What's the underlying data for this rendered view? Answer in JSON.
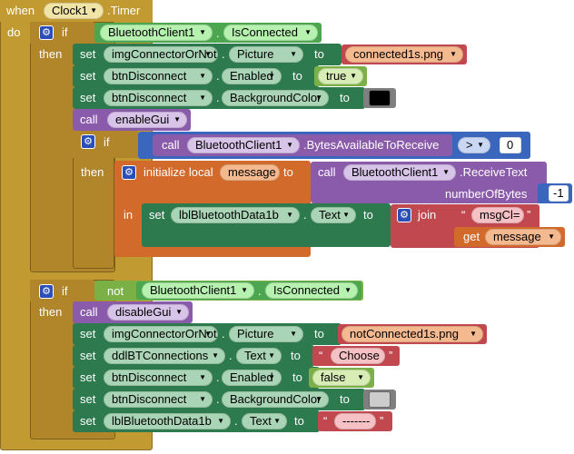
{
  "event": {
    "when": "when",
    "component": "Clock1",
    "event_name": ".Timer",
    "do": "do"
  },
  "kw": {
    "if": "if",
    "then": "then",
    "set": "set",
    "to": "to",
    "call": "call",
    "not": "not",
    "in": "in",
    "get": "get",
    "join": "join",
    "initialize_local": "initialize local",
    "param": "numberOfBytes",
    "open_quote": "“",
    "close_quote": "”"
  },
  "if1": {
    "condition": {
      "component": "BluetoothClient1",
      "property": "IsConnected"
    },
    "set1": {
      "component": "imgConnectorOrNot",
      "property": "Picture",
      "value": "connected1s.png"
    },
    "set2": {
      "component": "btnDisconnect",
      "property": "Enabled",
      "value": "true"
    },
    "set3": {
      "component": "btnDisconnect",
      "property": "BackgroundColor",
      "color": "#000000"
    },
    "call": {
      "procedure": "enableGui"
    },
    "inner_if": {
      "component": "BluetoothClient1",
      "method": ".BytesAvailableToReceive",
      "operator": ">",
      "compare_value": "0",
      "local_name": "message",
      "receive_component": "BluetoothClient1",
      "receive_method": ".ReceiveText",
      "bytes_value": "-1",
      "set_component": "lblBluetoothData1b",
      "set_property": "Text",
      "join_text": "msgCl=",
      "get_var": "message"
    }
  },
  "if2": {
    "condition": {
      "component": "BluetoothClient1",
      "property": "IsConnected"
    },
    "call": {
      "procedure": "disableGui"
    },
    "set1": {
      "component": "imgConnectorOrNot",
      "property": "Picture",
      "value": "notConnected1s.png"
    },
    "set2": {
      "component": "ddlBTConnections",
      "property": "Text",
      "value": "Choose"
    },
    "set3": {
      "component": "btnDisconnect",
      "property": "Enabled",
      "value": "false"
    },
    "set4": {
      "component": "btnDisconnect",
      "property": "BackgroundColor",
      "color": "#cccccc"
    },
    "set5": {
      "component": "lblBluetoothData1b",
      "property": "Text",
      "value": "-------"
    }
  },
  "colors": {
    "event": "#c19a31",
    "control": "#b1862a",
    "set": "#2e7a4f",
    "component": "#4ba64f",
    "text": "#c2484f",
    "logic": "#7ab045",
    "proc": "#8b5bab",
    "local": "#d26a2c",
    "math": "#3a67bd",
    "method_call": "#8b5bab"
  }
}
